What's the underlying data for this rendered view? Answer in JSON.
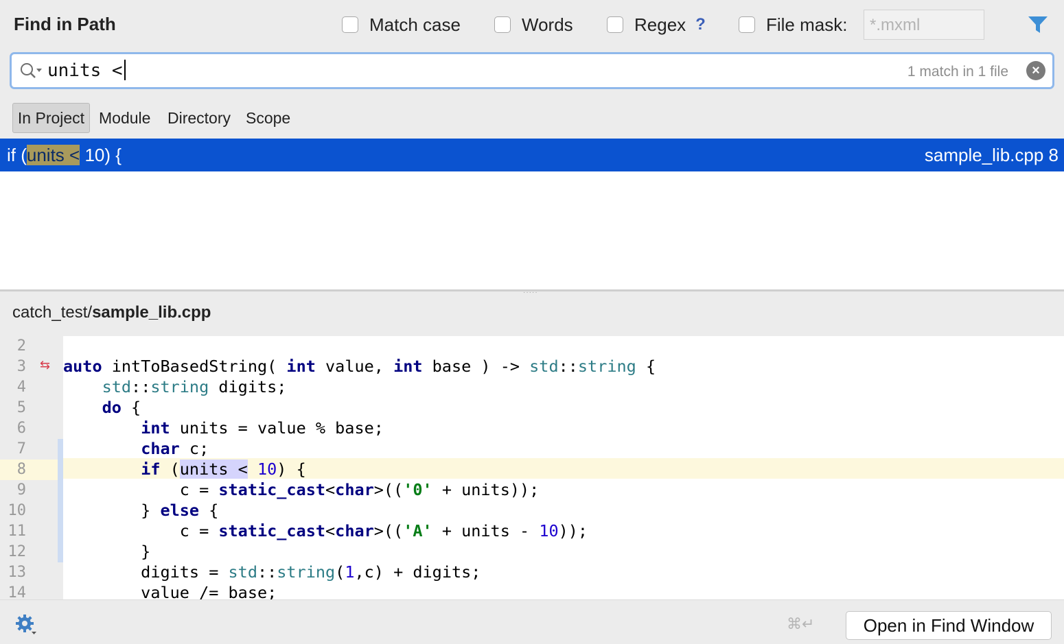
{
  "header": {
    "title": "Find in Path",
    "options": [
      {
        "label": "Match case",
        "checked": false
      },
      {
        "label": "Words",
        "checked": false
      },
      {
        "label": "Regex",
        "checked": false
      },
      {
        "label": "File mask:",
        "checked": false
      }
    ],
    "regex_help": "?",
    "file_mask_placeholder": "*.mxml"
  },
  "search": {
    "query": "units <",
    "match_count": "1 match in 1 file"
  },
  "scope_tabs": [
    {
      "label": "In Project",
      "selected": true
    },
    {
      "label": "Module",
      "selected": false
    },
    {
      "label": "Directory",
      "selected": false
    },
    {
      "label": "Scope",
      "selected": false
    }
  ],
  "results": [
    {
      "before": "if (",
      "match": "units <",
      "after": " 10) {",
      "file": "sample_lib.cpp 8"
    }
  ],
  "preview": {
    "path_prefix": "catch_test/",
    "file_name": "sample_lib.cpp",
    "current_line": 8,
    "line_numbers": [
      "2",
      "3",
      "4",
      "5",
      "6",
      "7",
      "8",
      "9",
      "10",
      "11",
      "12",
      "13",
      "14"
    ],
    "code_lines": [
      "",
      "auto intToBasedString( int value, int base ) -> std::string {",
      "    std::string digits;",
      "    do {",
      "        int units = value % base;",
      "        char c;",
      "        if (units < 10) {",
      "            c = static_cast<char>(('0' + units));",
      "        } else {",
      "            c = static_cast<char>(('A' + units - 10));",
      "        }",
      "        digits = std::string(1,c) + digits;",
      "        value /= base;"
    ]
  },
  "footer": {
    "shortcut": "⌘↵",
    "open_button": "Open in Find Window"
  },
  "colors": {
    "selection": "#0b53d0",
    "search_border": "#8fb8eb",
    "current_line": "#fdf8dd",
    "filter_icon": "#3d8fd6",
    "gear_icon": "#3f7fc4"
  }
}
